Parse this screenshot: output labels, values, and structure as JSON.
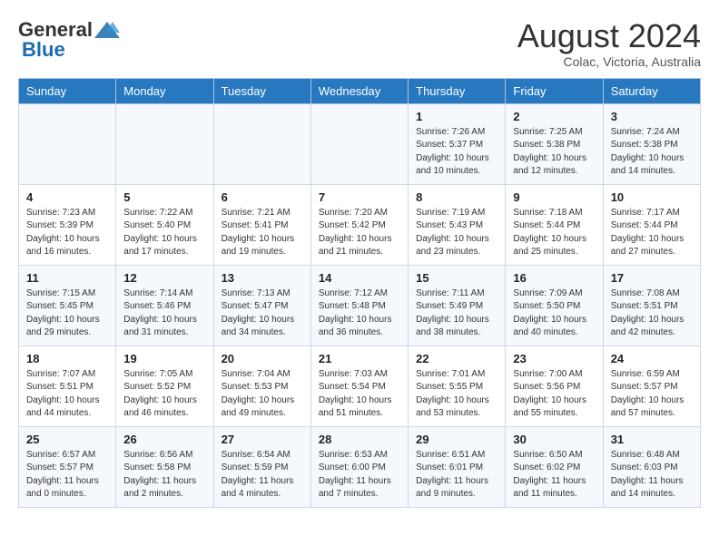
{
  "header": {
    "logo_general": "General",
    "logo_blue": "Blue",
    "title": "August 2024",
    "subtitle": "Colac, Victoria, Australia"
  },
  "weekdays": [
    "Sunday",
    "Monday",
    "Tuesday",
    "Wednesday",
    "Thursday",
    "Friday",
    "Saturday"
  ],
  "weeks": [
    [
      {
        "day": "",
        "info": ""
      },
      {
        "day": "",
        "info": ""
      },
      {
        "day": "",
        "info": ""
      },
      {
        "day": "",
        "info": ""
      },
      {
        "day": "1",
        "info": "Sunrise: 7:26 AM\nSunset: 5:37 PM\nDaylight: 10 hours\nand 10 minutes."
      },
      {
        "day": "2",
        "info": "Sunrise: 7:25 AM\nSunset: 5:38 PM\nDaylight: 10 hours\nand 12 minutes."
      },
      {
        "day": "3",
        "info": "Sunrise: 7:24 AM\nSunset: 5:38 PM\nDaylight: 10 hours\nand 14 minutes."
      }
    ],
    [
      {
        "day": "4",
        "info": "Sunrise: 7:23 AM\nSunset: 5:39 PM\nDaylight: 10 hours\nand 16 minutes."
      },
      {
        "day": "5",
        "info": "Sunrise: 7:22 AM\nSunset: 5:40 PM\nDaylight: 10 hours\nand 17 minutes."
      },
      {
        "day": "6",
        "info": "Sunrise: 7:21 AM\nSunset: 5:41 PM\nDaylight: 10 hours\nand 19 minutes."
      },
      {
        "day": "7",
        "info": "Sunrise: 7:20 AM\nSunset: 5:42 PM\nDaylight: 10 hours\nand 21 minutes."
      },
      {
        "day": "8",
        "info": "Sunrise: 7:19 AM\nSunset: 5:43 PM\nDaylight: 10 hours\nand 23 minutes."
      },
      {
        "day": "9",
        "info": "Sunrise: 7:18 AM\nSunset: 5:44 PM\nDaylight: 10 hours\nand 25 minutes."
      },
      {
        "day": "10",
        "info": "Sunrise: 7:17 AM\nSunset: 5:44 PM\nDaylight: 10 hours\nand 27 minutes."
      }
    ],
    [
      {
        "day": "11",
        "info": "Sunrise: 7:15 AM\nSunset: 5:45 PM\nDaylight: 10 hours\nand 29 minutes."
      },
      {
        "day": "12",
        "info": "Sunrise: 7:14 AM\nSunset: 5:46 PM\nDaylight: 10 hours\nand 31 minutes."
      },
      {
        "day": "13",
        "info": "Sunrise: 7:13 AM\nSunset: 5:47 PM\nDaylight: 10 hours\nand 34 minutes."
      },
      {
        "day": "14",
        "info": "Sunrise: 7:12 AM\nSunset: 5:48 PM\nDaylight: 10 hours\nand 36 minutes."
      },
      {
        "day": "15",
        "info": "Sunrise: 7:11 AM\nSunset: 5:49 PM\nDaylight: 10 hours\nand 38 minutes."
      },
      {
        "day": "16",
        "info": "Sunrise: 7:09 AM\nSunset: 5:50 PM\nDaylight: 10 hours\nand 40 minutes."
      },
      {
        "day": "17",
        "info": "Sunrise: 7:08 AM\nSunset: 5:51 PM\nDaylight: 10 hours\nand 42 minutes."
      }
    ],
    [
      {
        "day": "18",
        "info": "Sunrise: 7:07 AM\nSunset: 5:51 PM\nDaylight: 10 hours\nand 44 minutes."
      },
      {
        "day": "19",
        "info": "Sunrise: 7:05 AM\nSunset: 5:52 PM\nDaylight: 10 hours\nand 46 minutes."
      },
      {
        "day": "20",
        "info": "Sunrise: 7:04 AM\nSunset: 5:53 PM\nDaylight: 10 hours\nand 49 minutes."
      },
      {
        "day": "21",
        "info": "Sunrise: 7:03 AM\nSunset: 5:54 PM\nDaylight: 10 hours\nand 51 minutes."
      },
      {
        "day": "22",
        "info": "Sunrise: 7:01 AM\nSunset: 5:55 PM\nDaylight: 10 hours\nand 53 minutes."
      },
      {
        "day": "23",
        "info": "Sunrise: 7:00 AM\nSunset: 5:56 PM\nDaylight: 10 hours\nand 55 minutes."
      },
      {
        "day": "24",
        "info": "Sunrise: 6:59 AM\nSunset: 5:57 PM\nDaylight: 10 hours\nand 57 minutes."
      }
    ],
    [
      {
        "day": "25",
        "info": "Sunrise: 6:57 AM\nSunset: 5:57 PM\nDaylight: 11 hours\nand 0 minutes."
      },
      {
        "day": "26",
        "info": "Sunrise: 6:56 AM\nSunset: 5:58 PM\nDaylight: 11 hours\nand 2 minutes."
      },
      {
        "day": "27",
        "info": "Sunrise: 6:54 AM\nSunset: 5:59 PM\nDaylight: 11 hours\nand 4 minutes."
      },
      {
        "day": "28",
        "info": "Sunrise: 6:53 AM\nSunset: 6:00 PM\nDaylight: 11 hours\nand 7 minutes."
      },
      {
        "day": "29",
        "info": "Sunrise: 6:51 AM\nSunset: 6:01 PM\nDaylight: 11 hours\nand 9 minutes."
      },
      {
        "day": "30",
        "info": "Sunrise: 6:50 AM\nSunset: 6:02 PM\nDaylight: 11 hours\nand 11 minutes."
      },
      {
        "day": "31",
        "info": "Sunrise: 6:48 AM\nSunset: 6:03 PM\nDaylight: 11 hours\nand 14 minutes."
      }
    ]
  ]
}
